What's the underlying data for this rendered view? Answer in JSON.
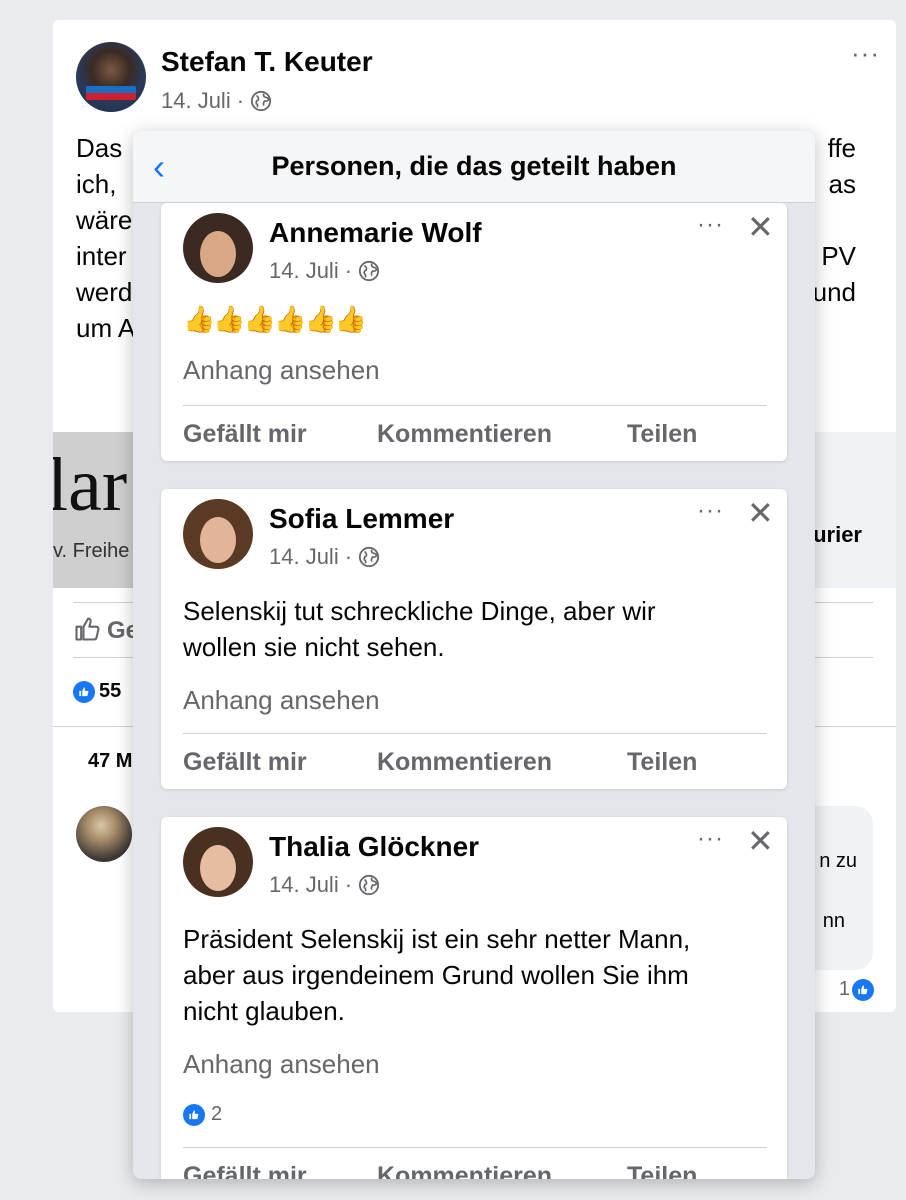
{
  "background_post": {
    "author": "Stefan T. Keuter",
    "date": "14. Juli",
    "date_separator": "·",
    "more": "···",
    "text_lines": [
      {
        "left": "Das",
        "right": "ffe"
      },
      {
        "left": "ich,",
        "right": "as"
      },
      {
        "left": "wäre",
        "right": ""
      },
      {
        "left": "inter",
        "right": "PV"
      },
      {
        "left": "werd",
        "right": "und"
      },
      {
        "left": "um A",
        "right": ""
      }
    ],
    "link_logo_text": "lar",
    "link_logo_sub": "v. Freihe",
    "link_source": "urier",
    "like_label": "Ge",
    "reaction_count": "55",
    "comments_count": "47 M",
    "comment_bubble_line1": "n zu",
    "comment_bubble_line2": "nn",
    "comment_reaction_count": "1"
  },
  "modal": {
    "title": "Personen, die das geteilt haben",
    "back_icon": "chevron-left-icon"
  },
  "shares": [
    {
      "name": "Annemarie Wolf",
      "date": "14. Juli",
      "text": "👍👍👍👍👍👍",
      "attachment": "Anhang ansehen",
      "actions": {
        "like": "Gefällt mir",
        "comment": "Kommentieren",
        "share": "Teilen"
      }
    },
    {
      "name": "Sofia Lemmer",
      "date": "14. Juli",
      "text_lines": [
        "Selenskij  tut schreckliche Dinge, aber wir",
        "wollen sie nicht sehen."
      ],
      "attachment": "Anhang ansehen",
      "actions": {
        "like": "Gefällt mir",
        "comment": "Kommentieren",
        "share": "Teilen"
      }
    },
    {
      "name": "Thalia Glöckner",
      "date": "14. Juli",
      "text_lines": [
        "Präsident Selenskij  ist ein sehr netter Mann,",
        "aber aus irgendeinem Grund wollen Sie ihm",
        "nicht glauben."
      ],
      "attachment": "Anhang ansehen",
      "reaction_count": "2",
      "actions": {
        "like": "Gefällt mir",
        "comment": "Kommentieren",
        "share": "Teilen"
      }
    }
  ],
  "colors": {
    "accent": "#1877f2",
    "secondary_text": "#65676b"
  }
}
